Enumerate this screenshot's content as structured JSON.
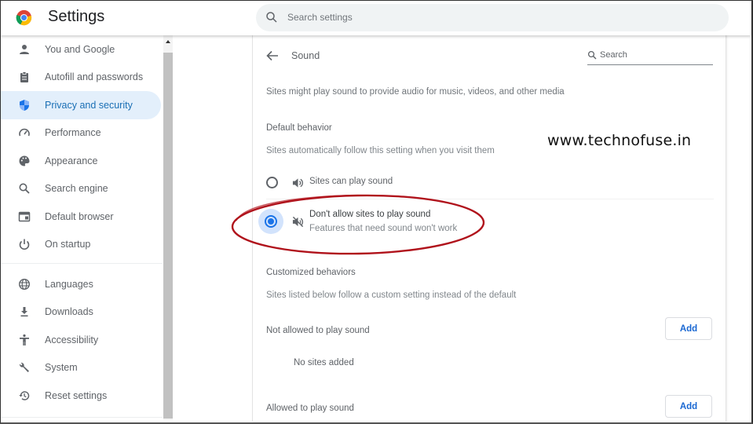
{
  "app": {
    "title": "Settings",
    "logo_icon": "chrome-logo-icon"
  },
  "search": {
    "placeholder": "Search settings",
    "value": "",
    "icon": "search-icon"
  },
  "sidebar": {
    "items": [
      {
        "label": "You and Google",
        "icon": "person-icon",
        "active": false
      },
      {
        "label": "Autofill and passwords",
        "icon": "clipboard-icon",
        "active": false
      },
      {
        "label": "Privacy and security",
        "icon": "shield-icon",
        "active": true
      },
      {
        "label": "Performance",
        "icon": "speedometer-icon",
        "active": false
      },
      {
        "label": "Appearance",
        "icon": "palette-icon",
        "active": false
      },
      {
        "label": "Search engine",
        "icon": "search-icon",
        "active": false
      },
      {
        "label": "Default browser",
        "icon": "browser-window-icon",
        "active": false
      },
      {
        "label": "On startup",
        "icon": "power-icon",
        "active": false
      },
      {
        "label": "Languages",
        "icon": "globe-icon",
        "active": false
      },
      {
        "label": "Downloads",
        "icon": "download-icon",
        "active": false
      },
      {
        "label": "Accessibility",
        "icon": "accessibility-icon",
        "active": false
      },
      {
        "label": "System",
        "icon": "wrench-icon",
        "active": false
      },
      {
        "label": "Reset settings",
        "icon": "reset-history-icon",
        "active": false
      }
    ]
  },
  "page": {
    "title": "Sound",
    "search_placeholder": "Search",
    "description": "Sites might play sound to provide audio for music, videos, and other media",
    "default_behavior": {
      "heading": "Default behavior",
      "subtext": "Sites automatically follow this setting when you visit them",
      "options": [
        {
          "label": "Sites can play sound",
          "sublabel": "",
          "icon": "volume-icon",
          "selected": false
        },
        {
          "label": "Don't allow sites to play sound",
          "sublabel": "Features that need sound won't work",
          "icon": "volume-off-icon",
          "selected": true
        }
      ]
    },
    "customized": {
      "heading": "Customized behaviors",
      "subtext": "Sites listed below follow a custom setting instead of the default",
      "lists": [
        {
          "label": "Not allowed to play sound",
          "button": "Add",
          "empty_text": "No sites added"
        },
        {
          "label": "Allowed to play sound",
          "button": "Add"
        }
      ]
    }
  },
  "watermark": "www.technofuse.in",
  "colors": {
    "accent": "#1a73e8",
    "active_nav_bg": "#e3effb",
    "annotation": "#b0121b"
  }
}
